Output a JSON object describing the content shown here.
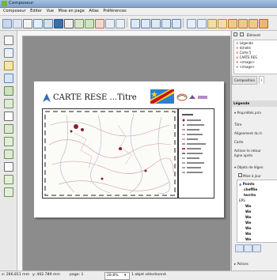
{
  "window": {
    "title": "Composeur"
  },
  "menu": [
    "Composeur",
    "Éditer",
    "Vue",
    "Mise en page",
    "Atlas",
    "Préférences"
  ],
  "page": {
    "map_title": "CARTE RESE ...Titre"
  },
  "right_panel": {
    "items_header": "Élément",
    "items": [
      "Légende",
      "échelle",
      "Carte 5",
      "CARTE RES",
      "<image>",
      "<image>"
    ],
    "tabs": [
      "Composition",
      "I"
    ],
    "legend_header": "Légende",
    "section_main": "Propriétés prin",
    "fields": [
      "Titre",
      "Alignement du ti",
      "Carte",
      "Activer le retour",
      "ligne après"
    ],
    "section_items": "Objets de légen",
    "auto_update": "Mise à jour",
    "tree_items": [
      "Points",
      "chefflie",
      "territo",
      "EPS",
      "We",
      "We",
      "We",
      "We",
      "We",
      "We",
      "We"
    ],
    "footer_section": "Polices"
  },
  "status": {
    "x": "x: 266.811 mm",
    "y": "y: 402.789 mm",
    "page": "page: 1",
    "zoom": "28.8%",
    "selection": "1 objet sélectionné"
  },
  "colors": {
    "titlebar": "#8aa8cf",
    "accent": "#2d6fb8"
  }
}
